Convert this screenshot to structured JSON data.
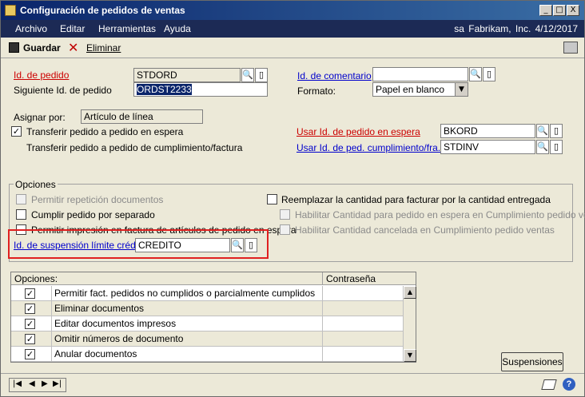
{
  "window": {
    "title": "Configuración de pedidos de ventas",
    "controls": {
      "minimize": "_",
      "maximize": "□",
      "close": "X"
    }
  },
  "menu": {
    "items": [
      "Archivo",
      "Editar",
      "Herramientas",
      "Ayuda"
    ],
    "right": "sa  Fabrikam, Inc.  4/12/2017"
  },
  "toolbar": {
    "save_label": "Guardar",
    "delete_label": "Eliminar"
  },
  "form": {
    "order_id_label": "Id. de pedido",
    "order_id_value": "STDORD",
    "next_order_id_label": "Siguiente Id. de pedido",
    "next_order_id_value": "ORDST2233",
    "comment_id_label": "Id. de comentario",
    "comment_id_value": "",
    "format_label": "Formato:",
    "format_value": "Papel en blanco",
    "assign_by_label": "Asignar por:",
    "assign_by_value": "Artículo de línea",
    "transfer_hold_label": "Transferir pedido a pedido en espera",
    "transfer_fulfill_label": "Transferir pedido a pedido de cumplimiento/factura",
    "use_hold_id_label": "Usar Id. de pedido en espera",
    "use_hold_id_value": "BKORD",
    "use_fulfill_id_label": "Usar Id. de ped. cumplimiento/fra.",
    "use_fulfill_id_value": "STDINV"
  },
  "options": {
    "group_label": "Opciones",
    "allow_repeat": "Permitir repetición documentos",
    "fulfill_separately": "Cumplir pedido por separado",
    "allow_print": "Permitir impresión en factura de artículos de pedido en espera",
    "replace_qty": "Reemplazar la cantidad para facturar por la cantidad entregada",
    "enable_qty_hold": "Habilitar Cantidad para pedido en espera en Cumplimiento pedido ventas",
    "enable_qty_cancel": "Habilitar Cantidad cancelada en Cumplimiento pedido ventas",
    "credit_hold_label": "Id. de suspensión límite crédito",
    "credit_hold_value": "CREDITO"
  },
  "grid": {
    "col_options": "Opciones:",
    "col_password": "Contraseña",
    "rows": [
      "Permitir fact. pedidos no cumplidos o parcialmente cumplidos",
      "Eliminar documentos",
      "Editar documentos impresos",
      "Omitir números de documento",
      "Anular documentos"
    ]
  },
  "buttons": {
    "suspensions": "Suspensiones"
  },
  "glyphs": {
    "check": "✓",
    "lookup": "🔍",
    "note": "▯",
    "dropdown": "▼",
    "up": "▲",
    "down": "▼"
  },
  "nav": [
    "|◀",
    "◀",
    "▶",
    "▶|"
  ]
}
